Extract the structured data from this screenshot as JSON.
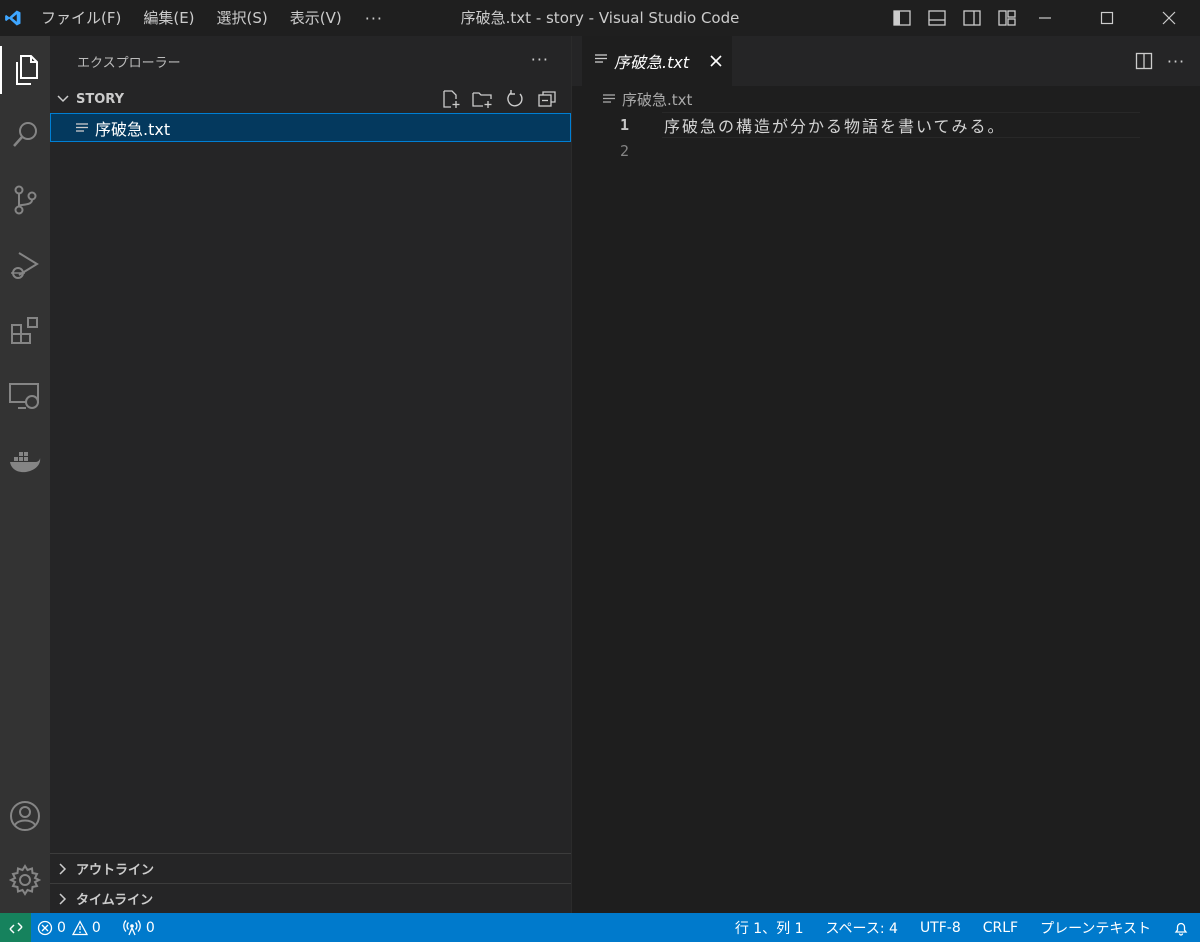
{
  "titlebar": {
    "menu": [
      "ファイル(F)",
      "編集(E)",
      "選択(S)",
      "表示(V)"
    ],
    "more": "···",
    "window_title": "序破急.txt - story - Visual Studio Code"
  },
  "sidebar": {
    "header": "エクスプローラー",
    "header_more": "···",
    "folder_name": "STORY",
    "files": [
      {
        "name": "序破急.txt",
        "selected": true
      }
    ],
    "sections": [
      "アウトライン",
      "タイムライン"
    ]
  },
  "editor": {
    "tab_label": "序破急.txt",
    "tab_more": "···",
    "breadcrumb": "序破急.txt",
    "lines": [
      {
        "number": "1",
        "text": "序破急の構造が分かる物語を書いてみる。"
      },
      {
        "number": "2",
        "text": ""
      }
    ]
  },
  "statusbar": {
    "errors": "0",
    "warnings": "0",
    "ports": "0",
    "position": "行 1、列 1",
    "indent": "スペース: 4",
    "encoding": "UTF-8",
    "eol": "CRLF",
    "language": "プレーンテキスト"
  },
  "colors": {
    "accent": "#007acc",
    "remote": "#16825d",
    "logo": "#3ea6ff",
    "selection": "#04395e"
  }
}
